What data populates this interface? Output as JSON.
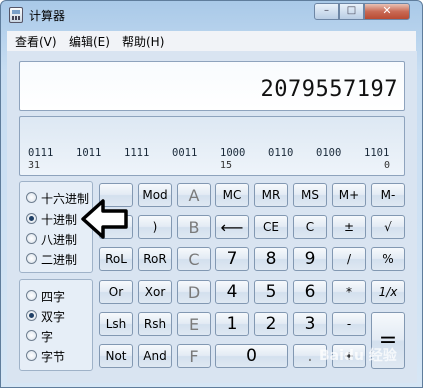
{
  "window": {
    "title": "计算器",
    "controls": {
      "minimize": "–",
      "maximize": "□",
      "close": "✕"
    }
  },
  "menu": [
    "查看(V)",
    "编辑(E)",
    "帮助(H)"
  ],
  "display": {
    "value": "2079557197"
  },
  "bits": {
    "groups": [
      "0111",
      "1011",
      "1111",
      "0011",
      "1000",
      "0110",
      "0100",
      "1101"
    ],
    "labels": [
      "31",
      "15",
      "0"
    ]
  },
  "base_options": [
    {
      "label": "十六进制",
      "checked": false
    },
    {
      "label": "十进制",
      "checked": true
    },
    {
      "label": "八进制",
      "checked": false
    },
    {
      "label": "二进制",
      "checked": false
    }
  ],
  "word_options": [
    {
      "label": "四字",
      "checked": false
    },
    {
      "label": "双字",
      "checked": true
    },
    {
      "label": "字",
      "checked": false
    },
    {
      "label": "字节",
      "checked": false
    }
  ],
  "buttons": {
    "mod": "Mod",
    "A": "A",
    "MC": "MC",
    "MR": "MR",
    "MS": "MS",
    "Mplus": "M+",
    "Mminus": "M-",
    "rparen": ")",
    "B": "B",
    "back": "⟵",
    "CE": "CE",
    "C": "C",
    "pm": "±",
    "sqrt": "√",
    "RoL": "RoL",
    "RoR": "RoR",
    "Cl": "C",
    "n7": "7",
    "n8": "8",
    "n9": "9",
    "div": "/",
    "pct": "%",
    "Or": "Or",
    "Xor": "Xor",
    "D": "D",
    "n4": "4",
    "n5": "5",
    "n6": "6",
    "mul": "*",
    "recip": "1/x",
    "Lsh": "Lsh",
    "Rsh": "Rsh",
    "E": "E",
    "n1": "1",
    "n2": "2",
    "n3": "3",
    "minus": "-",
    "eq": "=",
    "Not": "Not",
    "And": "And",
    "F": "F",
    "n0": "0",
    "dot": ".",
    "plus": "+"
  },
  "watermark": "Baidu 经验"
}
